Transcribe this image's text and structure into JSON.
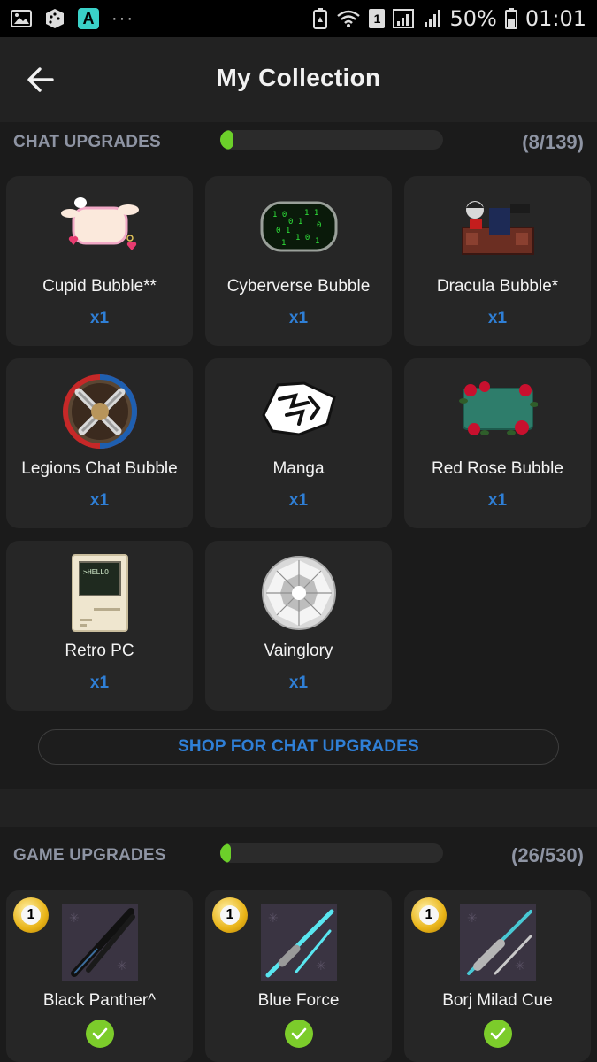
{
  "status_bar": {
    "battery": "50%",
    "time": "01:01",
    "sim": "1",
    "more": "···"
  },
  "header": {
    "title": "My Collection"
  },
  "chat_upgrades": {
    "title": "CHAT UPGRADES",
    "count": "(8/139)",
    "progress_fraction": 0.058,
    "items": [
      {
        "name": "Cupid Bubble**",
        "qty": "x1",
        "icon": "cupid-bubble-icon"
      },
      {
        "name": "Cyberverse Bubble",
        "qty": "x1",
        "icon": "cyberverse-bubble-icon"
      },
      {
        "name": "Dracula Bubble*",
        "qty": "x1",
        "icon": "dracula-bubble-icon"
      },
      {
        "name": "Legions Chat Bubble",
        "qty": "x1",
        "icon": "legions-bubble-icon"
      },
      {
        "name": "Manga",
        "qty": "x1",
        "icon": "manga-bubble-icon"
      },
      {
        "name": "Red Rose Bubble",
        "qty": "x1",
        "icon": "red-rose-bubble-icon"
      },
      {
        "name": "Retro PC",
        "qty": "x1",
        "icon": "retro-pc-icon",
        "screen_text": ">HELLO"
      },
      {
        "name": "Vainglory",
        "qty": "x1",
        "icon": "diamond-icon"
      }
    ],
    "shop_label": "SHOP FOR CHAT UPGRADES"
  },
  "game_upgrades": {
    "title": "GAME UPGRADES",
    "count": "(26/530)",
    "progress_fraction": 0.049,
    "items": [
      {
        "name": "Black Panther^",
        "icon": "black-panther-cue-icon",
        "coin": "1",
        "owned": true
      },
      {
        "name": "Blue Force",
        "icon": "blue-force-cue-icon",
        "coin": "1",
        "owned": true
      },
      {
        "name": "Borj Milad Cue",
        "icon": "borj-milad-cue-icon",
        "coin": "1",
        "owned": true
      }
    ]
  },
  "colors": {
    "accent_blue": "#2f7fd6",
    "progress_green": "#6cd02a",
    "check_green": "#7ccc2b",
    "section_label_gray": "#8e94a3"
  }
}
